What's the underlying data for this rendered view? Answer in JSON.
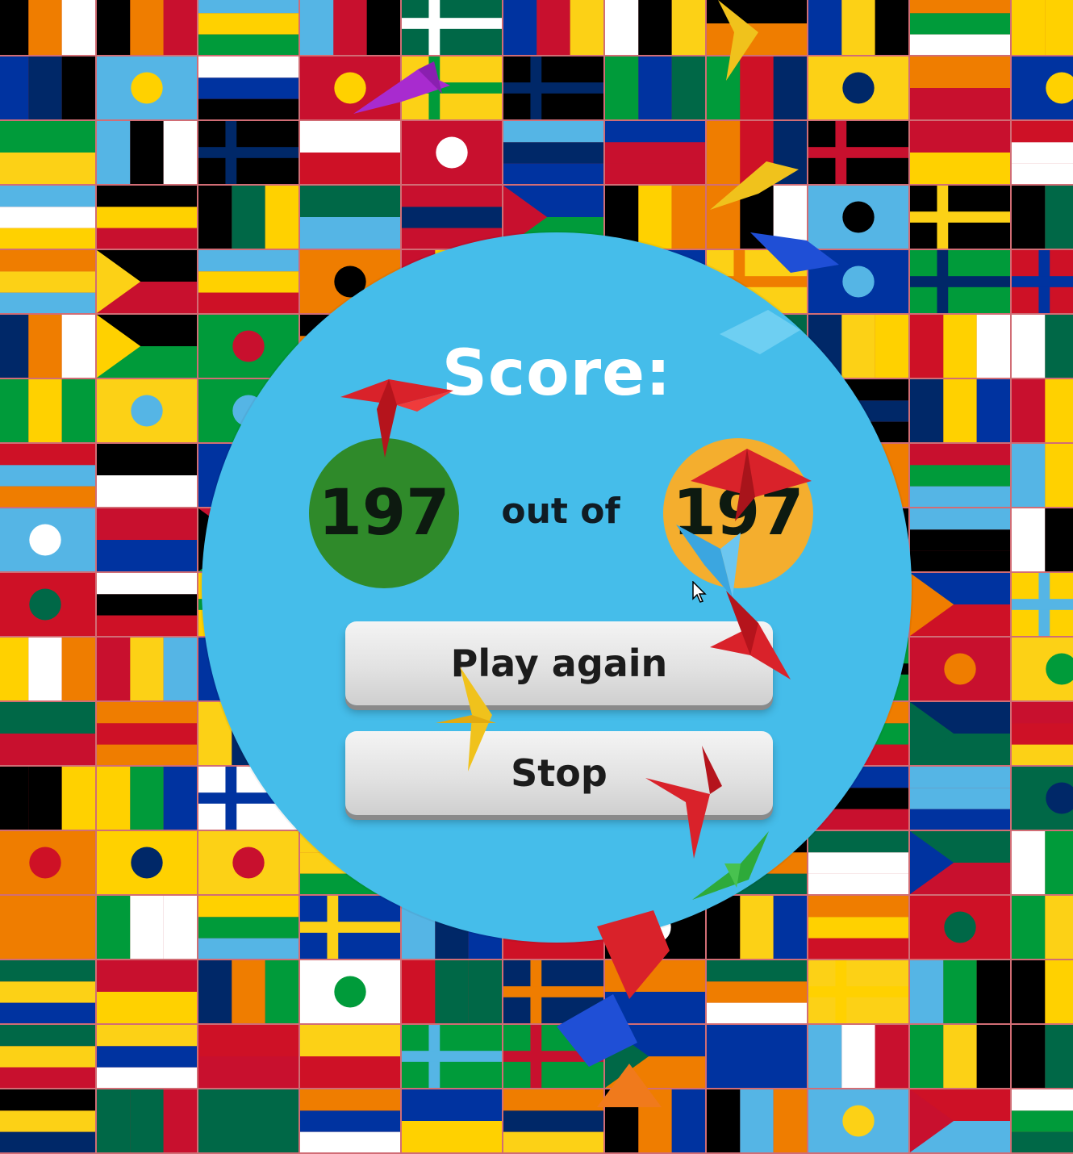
{
  "score": {
    "title": "Score:",
    "achieved": "197",
    "separator": "out of",
    "total": "197"
  },
  "buttons": {
    "play_again": "Play again",
    "stop": "Stop"
  },
  "colors": {
    "dialog": "#45bdea",
    "achieved_circle": "#2f8a2a",
    "total_circle": "#f4ae2e",
    "title_text": "#ffffff"
  },
  "decorations": {
    "background": "world-flags-wall",
    "flying_objects": "origami-cranes"
  }
}
